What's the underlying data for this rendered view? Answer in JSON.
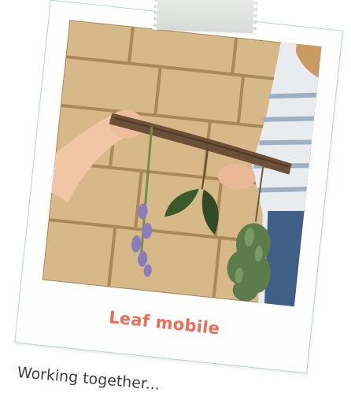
{
  "card": {
    "caption": "Leaf mobile",
    "caption_color": "#ef6b5a",
    "border_color": "#b9d6c8"
  },
  "photo": {
    "icon": "leaf-mobile-photo"
  },
  "body": {
    "text": "Working together..."
  }
}
